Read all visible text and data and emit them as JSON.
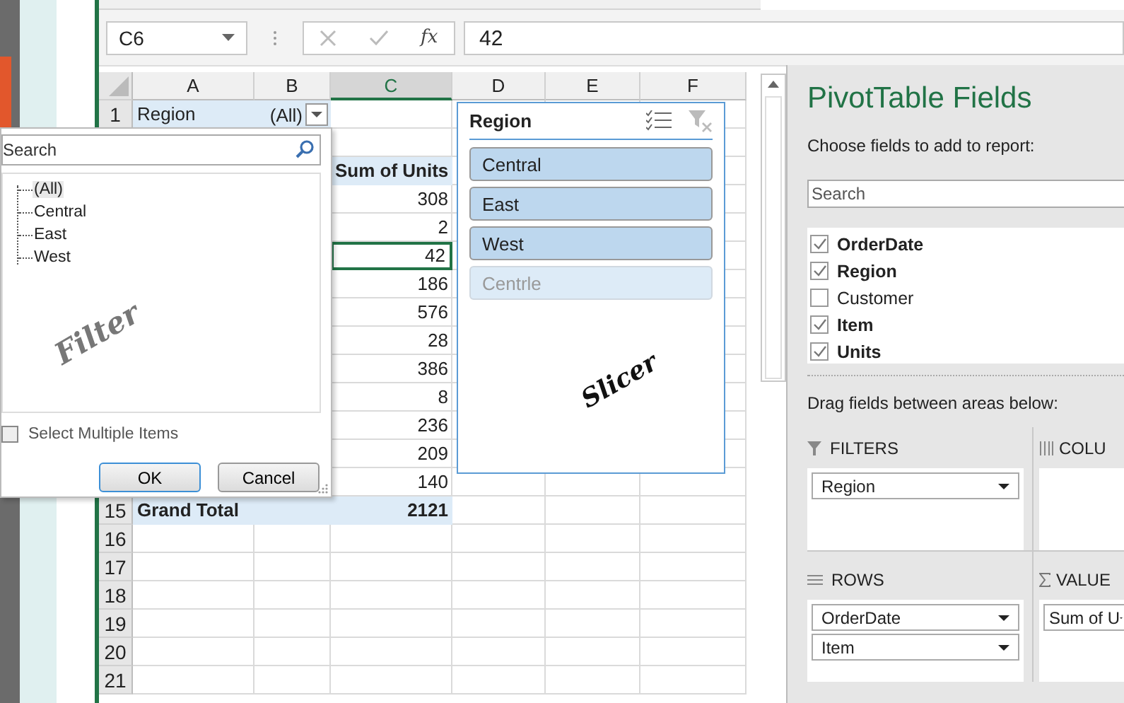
{
  "formula_bar": {
    "name_box": "C6",
    "function_symbol": "fx",
    "formula": "42"
  },
  "sheet": {
    "columns": [
      {
        "label": "A",
        "selected": false
      },
      {
        "label": "B",
        "selected": false
      },
      {
        "label": "C",
        "selected": true
      },
      {
        "label": "D",
        "selected": false
      },
      {
        "label": "E",
        "selected": false
      },
      {
        "label": "F",
        "selected": false
      }
    ],
    "rows": [
      {
        "kind": "filter",
        "number": "1",
        "label": "Region",
        "value": "(All)"
      },
      {
        "kind": "blank"
      },
      {
        "kind": "header",
        "value": "Sum of Units"
      },
      {
        "kind": "value",
        "value": "308",
        "selected": false
      },
      {
        "kind": "value",
        "value": "2",
        "selected": false
      },
      {
        "kind": "value",
        "value": "42",
        "selected": true
      },
      {
        "kind": "value",
        "value": "186",
        "selected": false
      },
      {
        "kind": "value",
        "value": "576",
        "selected": false
      },
      {
        "kind": "value",
        "value": "28",
        "selected": false
      },
      {
        "kind": "value",
        "value": "386",
        "selected": false
      },
      {
        "kind": "value",
        "value": "8",
        "selected": false
      },
      {
        "kind": "value",
        "value": "236",
        "selected": false
      },
      {
        "kind": "value",
        "value": "209",
        "selected": false
      },
      {
        "kind": "value",
        "value": "140",
        "selected": false
      },
      {
        "kind": "total",
        "number": "15",
        "label": "Grand Total",
        "value": "2121"
      },
      {
        "kind": "blank",
        "number": "16"
      },
      {
        "kind": "blank",
        "number": "17"
      },
      {
        "kind": "blank",
        "number": "18"
      },
      {
        "kind": "blank",
        "number": "19"
      },
      {
        "kind": "blank",
        "number": "20"
      },
      {
        "kind": "blank",
        "number": "21"
      }
    ]
  },
  "filter_dropdown": {
    "search": {
      "placeholder": "Search"
    },
    "items": [
      {
        "label": "(All)",
        "selected": true
      },
      {
        "label": "Central",
        "selected": false
      },
      {
        "label": "East",
        "selected": false
      },
      {
        "label": "West",
        "selected": false
      }
    ],
    "annotation": "Filter",
    "select_multiple": {
      "label": "Select Multiple Items",
      "checked": false
    },
    "buttons": [
      "OK",
      "Cancel"
    ]
  },
  "slicer": {
    "title": "Region",
    "items": [
      {
        "label": "Central",
        "selected": true
      },
      {
        "label": "East",
        "selected": true
      },
      {
        "label": "West",
        "selected": true
      },
      {
        "label": "Centrle",
        "selected": false
      }
    ],
    "annotation": "Slicer"
  },
  "pivot_panel": {
    "title": "PivotTable Fields",
    "subtitle": "Choose fields to add to report:",
    "search": {
      "placeholder": "Search"
    },
    "fields": [
      {
        "label": "OrderDate",
        "checked": true
      },
      {
        "label": "Region",
        "checked": true
      },
      {
        "label": "Customer",
        "checked": false
      },
      {
        "label": "Item",
        "checked": true
      },
      {
        "label": "Units",
        "checked": true
      }
    ],
    "areas_hint": "Drag fields between areas below:",
    "areas": [
      {
        "kind": "filters",
        "title": "FILTERS",
        "fields": [
          "Region"
        ]
      },
      {
        "kind": "columns",
        "title": "COLU"
      },
      {
        "kind": "rows",
        "title": "ROWS",
        "fields": [
          "OrderDate",
          "Item"
        ]
      },
      {
        "kind": "values",
        "title": "VALUE",
        "fields": [
          "Sum of U"
        ]
      }
    ]
  }
}
